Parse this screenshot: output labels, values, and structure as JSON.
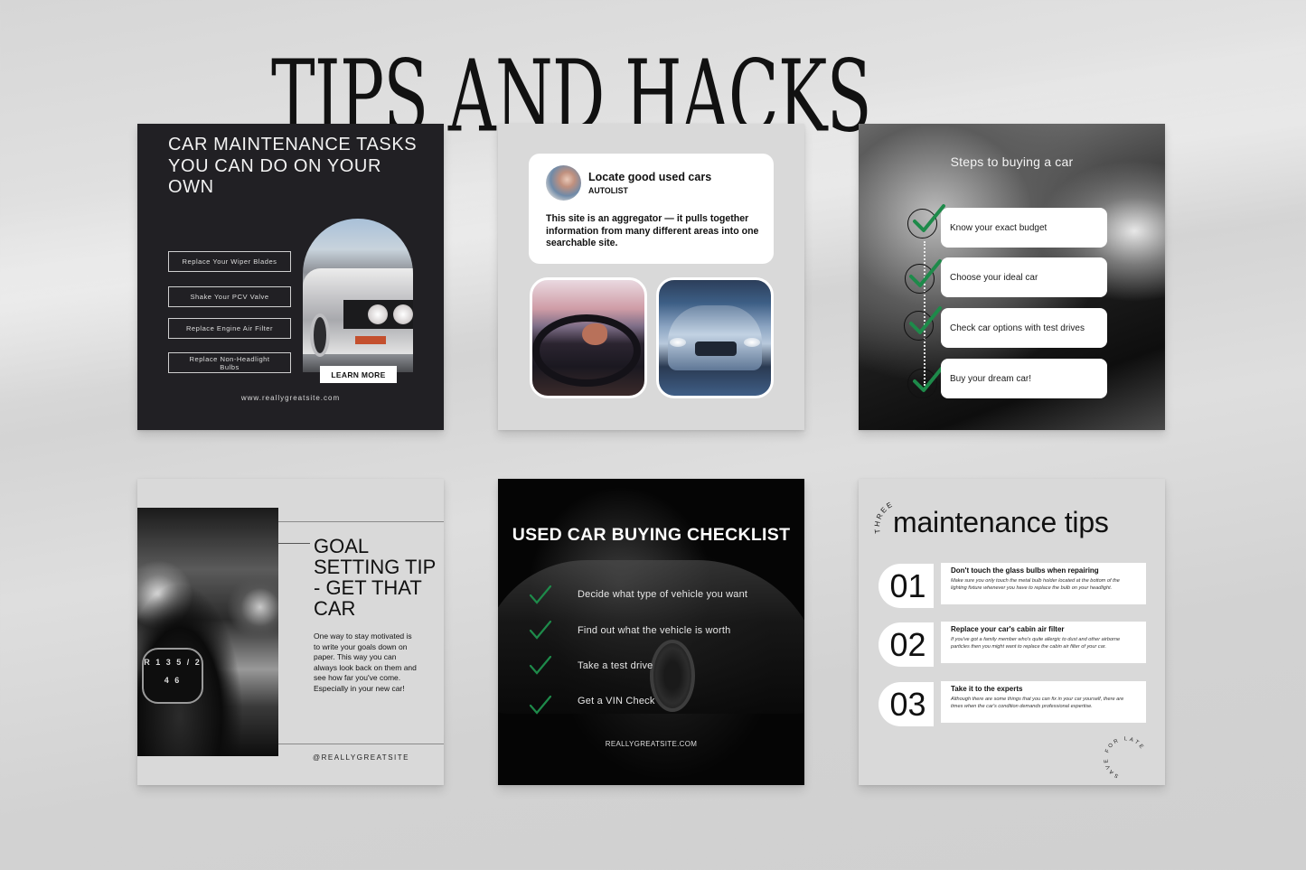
{
  "page_title": "TIPS AND HACKS",
  "cards": {
    "card1": {
      "title": "CAR MAINTENANCE TASKS YOU CAN DO ON YOUR OWN",
      "tasks": [
        "Replace Your Wiper Blades",
        "Shake Your PCV Valve",
        "Replace Engine Air Filter",
        "Replace Non-Headlight Bulbs"
      ],
      "cta": "LEARN MORE",
      "website": "www.reallygreatsite.com"
    },
    "card2": {
      "post_title": "Locate good used cars",
      "post_source": "AUTOLIST",
      "post_body": "This site is an aggregator — it pulls together information from many different areas into one searchable site.",
      "photos": [
        "driver-at-steering-wheel-photo",
        "mercedes-front-photo"
      ]
    },
    "card3": {
      "title": "Steps to buying a car",
      "steps": [
        "Know your exact budget",
        "Choose your ideal car",
        "Check car options with test drives",
        "Buy your dream car!"
      ],
      "check_color": "#1e8a4a"
    },
    "card4": {
      "title": "GOAL SETTING TIP - GET THAT CAR",
      "gear_labels": "R 1 3 5 / 2 4 6",
      "body": "One way to stay motivated is to write your goals down on paper. This way you can always look back on them and see how far you've come. Especially in your new car!",
      "handle": "@REALLYGREATSITE"
    },
    "card5": {
      "title": "USED CAR BUYING CHECKLIST",
      "items": [
        "Decide what type of vehicle you want",
        "Find out what the vehicle is worth",
        "Take a test drive",
        "Get a VIN Check"
      ],
      "website": "REALLYGREATSITE.COM",
      "check_color": "#1e8a4a"
    },
    "card6": {
      "kicker": "THREE",
      "title": "maintenance tips",
      "tips": [
        {
          "number": "01",
          "title": "Don't touch the glass bulbs when repairing",
          "body": "Make sure you only touch the metal bulb holder located at the bottom of the lighting fixture whenever you have to replace the bulb on your headlight."
        },
        {
          "number": "02",
          "title": "Replace your car's cabin air filter",
          "body": "If you've got a family member who's quite allergic to dust and other airborne particles then you might want to replace the cabin air filter of your car."
        },
        {
          "number": "03",
          "title": "Take it to the experts",
          "body": "Although there are some things that you can fix in your car yourself, there are times when the car's condition demands professional expertise."
        }
      ],
      "badge": "SAVE FOR LATER"
    }
  }
}
